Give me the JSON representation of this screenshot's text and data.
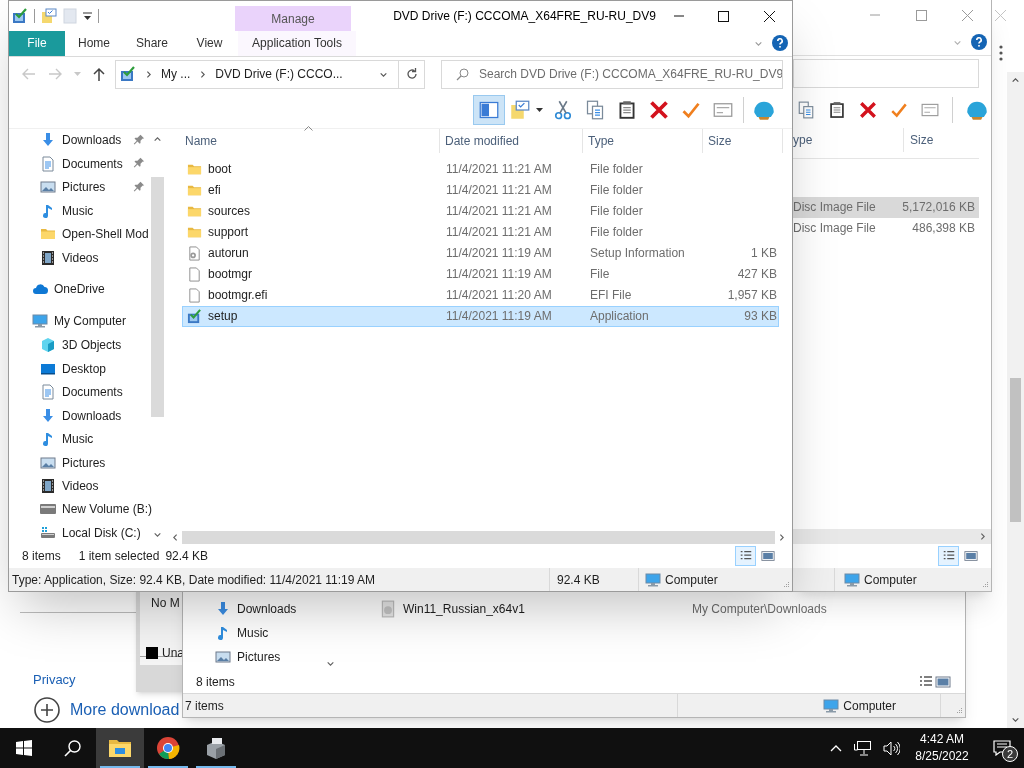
{
  "browser_page": {
    "privacy_link": "Privacy",
    "more_link": "More download"
  },
  "dialog": {
    "text": "No M",
    "checkbox": {
      "label": "Una",
      "checked": true
    }
  },
  "downloads_window": {
    "nav_items": [
      {
        "label": "Downloads",
        "kind": "downloads"
      },
      {
        "label": "Music",
        "kind": "music"
      },
      {
        "label": "Pictures",
        "kind": "pictures"
      }
    ],
    "files": [
      {
        "name": "Win11_Russian_x64v1",
        "location": "My Computer\\Downloads"
      }
    ],
    "pane_status": "8 items",
    "status_count": "7 items",
    "status_location": "Computer"
  },
  "back_window": {
    "columns": [
      "ype",
      "Size"
    ],
    "rows": [
      {
        "type": "Disc Image File",
        "size": "5,172,016 KB",
        "selected": true
      },
      {
        "type": "Disc Image File",
        "size": "486,398 KB",
        "selected": false
      }
    ],
    "view_buttons": [
      {
        "kind": "details",
        "selected": true
      },
      {
        "kind": "thumbnails",
        "selected": false
      }
    ],
    "status_location": "Computer"
  },
  "window": {
    "title": "DVD Drive (F:) CCCOMA_X64FRE_RU-RU_DV9",
    "context_group": "Manage",
    "ribbon_tabs": [
      {
        "label": "File",
        "kind": "file",
        "selected": false
      },
      {
        "label": "Home",
        "kind": "plain",
        "selected": false
      },
      {
        "label": "Share",
        "kind": "plain",
        "selected": false
      },
      {
        "label": "View",
        "kind": "plain",
        "selected": false
      },
      {
        "label": "Application Tools",
        "kind": "contextual",
        "selected": false
      }
    ],
    "breadcrumbs": [
      "My ...",
      "DVD Drive (F:) CCCO..."
    ],
    "search": {
      "placeholder": "Search DVD Drive (F:) CCCOMA_X64FRE_RU-RU_DV9"
    },
    "toolbar": [
      {
        "kind": "pane",
        "on": true
      },
      {
        "kind": "properties",
        "on": false
      },
      {
        "kind": "cut",
        "on": false
      },
      {
        "kind": "copy",
        "on": false
      },
      {
        "kind": "paste",
        "on": false
      },
      {
        "kind": "delete",
        "on": false
      },
      {
        "kind": "check",
        "on": false
      },
      {
        "kind": "envelope",
        "on": false
      },
      {
        "kind": "shell",
        "on": false
      }
    ],
    "quick_access": [
      {
        "label": "Downloads",
        "kind": "downloads",
        "pinned": true
      },
      {
        "label": "Documents",
        "kind": "documents",
        "pinned": true
      },
      {
        "label": "Pictures",
        "kind": "pictures",
        "pinned": true
      },
      {
        "label": "Music",
        "kind": "music",
        "pinned": false
      },
      {
        "label": "Open-Shell Mod",
        "kind": "folder",
        "pinned": false
      },
      {
        "label": "Videos",
        "kind": "videos",
        "pinned": false
      }
    ],
    "nav_roots": [
      {
        "label": "OneDrive",
        "kind": "cloud"
      },
      {
        "label": "My Computer",
        "kind": "computer",
        "children": [
          {
            "label": "3D Objects",
            "kind": "objects"
          },
          {
            "label": "Desktop",
            "kind": "desktop"
          },
          {
            "label": "Documents",
            "kind": "documents"
          },
          {
            "label": "Downloads",
            "kind": "downloads"
          },
          {
            "label": "Music",
            "kind": "music"
          },
          {
            "label": "Pictures",
            "kind": "pictures"
          },
          {
            "label": "Videos",
            "kind": "videos"
          },
          {
            "label": "New Volume (B:)",
            "kind": "volume"
          },
          {
            "label": "Local Disk (C:)",
            "kind": "system"
          }
        ]
      }
    ],
    "columns": [
      "Name",
      "Date modified",
      "Type",
      "Size"
    ],
    "files": [
      {
        "name": "boot",
        "date": "11/4/2021 11:21 AM",
        "type": "File folder",
        "kind": "folder",
        "selected": false
      },
      {
        "name": "efi",
        "date": "11/4/2021 11:21 AM",
        "type": "File folder",
        "kind": "folder",
        "selected": false
      },
      {
        "name": "sources",
        "date": "11/4/2021 11:21 AM",
        "type": "File folder",
        "kind": "folder",
        "selected": false
      },
      {
        "name": "support",
        "date": "11/4/2021 11:21 AM",
        "type": "File folder",
        "kind": "folder",
        "selected": false
      },
      {
        "name": "autorun",
        "date": "11/4/2021 11:19 AM",
        "type": "Setup Information",
        "size": "1 KB",
        "kind": "settings",
        "selected": false
      },
      {
        "name": "bootmgr",
        "date": "11/4/2021 11:19 AM",
        "type": "File",
        "size": "427 KB",
        "kind": "file",
        "selected": false
      },
      {
        "name": "bootmgr.efi",
        "date": "11/4/2021 11:20 AM",
        "type": "EFI File",
        "size": "1,957 KB",
        "kind": "file",
        "selected": false
      },
      {
        "name": "setup",
        "date": "11/4/2021 11:19 AM",
        "type": "Application",
        "size": "93 KB",
        "kind": "application",
        "selected": true
      }
    ],
    "item_count": "8 items",
    "selection": "1 item selected",
    "selection_size": "92.4 KB",
    "view_buttons": [
      {
        "kind": "details",
        "selected": true
      },
      {
        "kind": "thumbnails",
        "selected": false
      }
    ],
    "details_bar": {
      "summary": "Type: Application, Size: 92.4 KB, Date modified: 11/4/2021 11:19 AM",
      "size": "92.4 KB",
      "location": "Computer"
    }
  },
  "taskbar": {
    "apps": [
      {
        "kind": "explorer",
        "active": true
      },
      {
        "kind": "browser",
        "active": false
      },
      {
        "kind": "installer",
        "active": false
      }
    ],
    "time": "4:42 AM",
    "date": "8/25/2022",
    "notification_count": "2"
  }
}
